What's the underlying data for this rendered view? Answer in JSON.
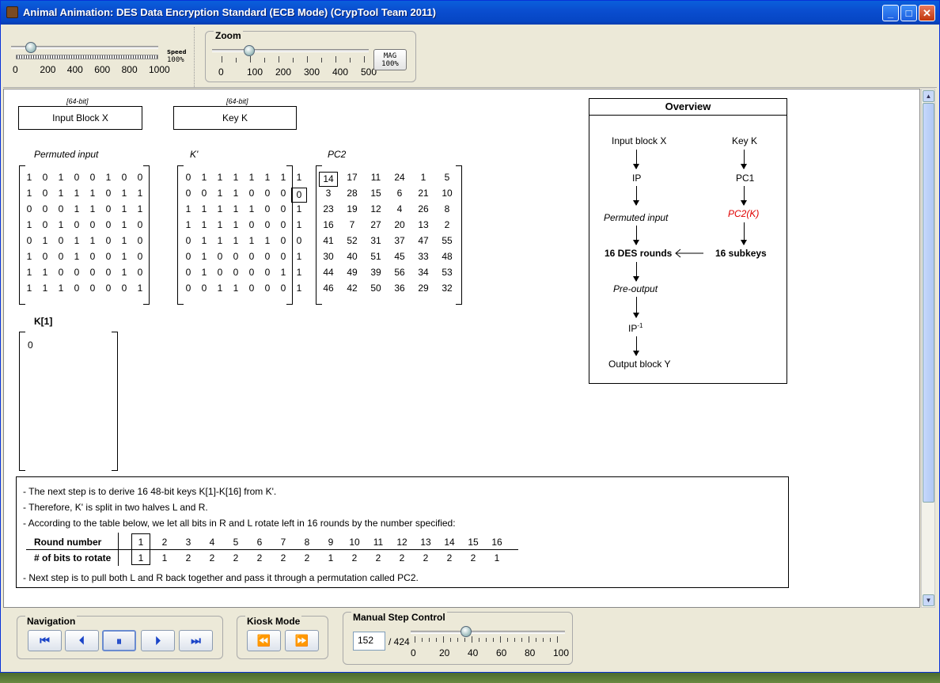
{
  "window": {
    "title": "Animal Animation: DES Data Encryption Standard (ECB Mode) (CrypTool Team 2011)"
  },
  "speed": {
    "label": "Speed",
    "value": "100%",
    "ticks": [
      "0",
      "200",
      "400",
      "600",
      "800",
      "1000"
    ]
  },
  "zoom": {
    "label": "Zoom",
    "ticks": [
      "0",
      "100",
      "200",
      "300",
      "400",
      "500"
    ],
    "mag_label": "MAG",
    "mag_value": "100%"
  },
  "input_block": {
    "bits_label": "[64-bit]",
    "label": "Input Block X"
  },
  "key_block": {
    "bits_label": "[64-bit]",
    "label": "Key K"
  },
  "matrices": {
    "permuted_input": {
      "title": "Permuted input",
      "rows": [
        [
          "1",
          "0",
          "1",
          "0",
          "0",
          "1",
          "0",
          "0"
        ],
        [
          "1",
          "0",
          "1",
          "1",
          "1",
          "0",
          "1",
          "1"
        ],
        [
          "0",
          "0",
          "0",
          "1",
          "1",
          "0",
          "1",
          "1"
        ],
        [
          "1",
          "0",
          "1",
          "0",
          "0",
          "0",
          "1",
          "0"
        ],
        [
          "0",
          "1",
          "0",
          "1",
          "1",
          "0",
          "1",
          "0"
        ],
        [
          "1",
          "0",
          "0",
          "1",
          "0",
          "0",
          "1",
          "0"
        ],
        [
          "1",
          "1",
          "0",
          "0",
          "0",
          "0",
          "1",
          "0"
        ],
        [
          "1",
          "1",
          "1",
          "0",
          "0",
          "0",
          "0",
          "1"
        ]
      ]
    },
    "k_prime": {
      "title": "K'",
      "rows": [
        [
          "0",
          "1",
          "1",
          "1",
          "1",
          "1",
          "1",
          "1"
        ],
        [
          "0",
          "0",
          "1",
          "1",
          "0",
          "0",
          "0",
          "0"
        ],
        [
          "1",
          "1",
          "1",
          "1",
          "1",
          "0",
          "0",
          "1"
        ],
        [
          "1",
          "1",
          "1",
          "1",
          "0",
          "0",
          "0",
          "1"
        ],
        [
          "0",
          "1",
          "1",
          "1",
          "1",
          "1",
          "0",
          "0"
        ],
        [
          "0",
          "1",
          "0",
          "0",
          "0",
          "0",
          "0",
          "1"
        ],
        [
          "0",
          "1",
          "0",
          "0",
          "0",
          "0",
          "1",
          "1"
        ],
        [
          "0",
          "0",
          "1",
          "1",
          "0",
          "0",
          "0",
          "1"
        ]
      ]
    },
    "pc2": {
      "title": "PC2",
      "rows": [
        [
          "14",
          "17",
          "11",
          "24",
          "1",
          "5"
        ],
        [
          "3",
          "28",
          "15",
          "6",
          "21",
          "10"
        ],
        [
          "23",
          "19",
          "12",
          "4",
          "26",
          "8"
        ],
        [
          "16",
          "7",
          "27",
          "20",
          "13",
          "2"
        ],
        [
          "41",
          "52",
          "31",
          "37",
          "47",
          "55"
        ],
        [
          "30",
          "40",
          "51",
          "45",
          "33",
          "48"
        ],
        [
          "44",
          "49",
          "39",
          "56",
          "34",
          "53"
        ],
        [
          "46",
          "42",
          "50",
          "36",
          "29",
          "32"
        ]
      ]
    },
    "k1": {
      "title": "K[1]",
      "value": "0"
    }
  },
  "overview": {
    "title": "Overview",
    "input_block": "Input block X",
    "key": "Key K",
    "ip": "IP",
    "pc1": "PC1",
    "permuted_input": "Permuted input",
    "pc2k": "PC2(K)",
    "des_rounds": "16 DES rounds",
    "subkeys": "16 subkeys",
    "pre_output": "Pre-output",
    "ip_inv": "IP",
    "ip_inv_sup": "-1",
    "output_block": "Output block Y",
    "highlight_color": "#e00000"
  },
  "description": {
    "line1": "- The next step is to derive 16 48-bit keys K[1]-K[16] from K'.",
    "line2": "- Therefore, K' is split in two halves L and R.",
    "line3": "- According to the table below, we let all bits in R and L rotate left in 16 rounds by the number specified:",
    "row1_label": "Round number",
    "row2_label": "# of bits to rotate",
    "rounds": [
      "1",
      "2",
      "3",
      "4",
      "5",
      "6",
      "7",
      "8",
      "9",
      "10",
      "11",
      "12",
      "13",
      "14",
      "15",
      "16"
    ],
    "rotations": [
      "1",
      "1",
      "2",
      "2",
      "2",
      "2",
      "2",
      "2",
      "1",
      "2",
      "2",
      "2",
      "2",
      "2",
      "2",
      "1"
    ],
    "line4": "- Next step is to pull both L and R back together and pass it through a permutation called PC2."
  },
  "navigation": {
    "label": "Navigation"
  },
  "kiosk": {
    "label": "Kiosk Mode"
  },
  "manual": {
    "label": "Manual Step Control",
    "current_step": "152",
    "total": "/ 424",
    "ticks": [
      "0",
      "20",
      "40",
      "60",
      "80",
      "100"
    ],
    "progress_fraction": 0.36
  }
}
